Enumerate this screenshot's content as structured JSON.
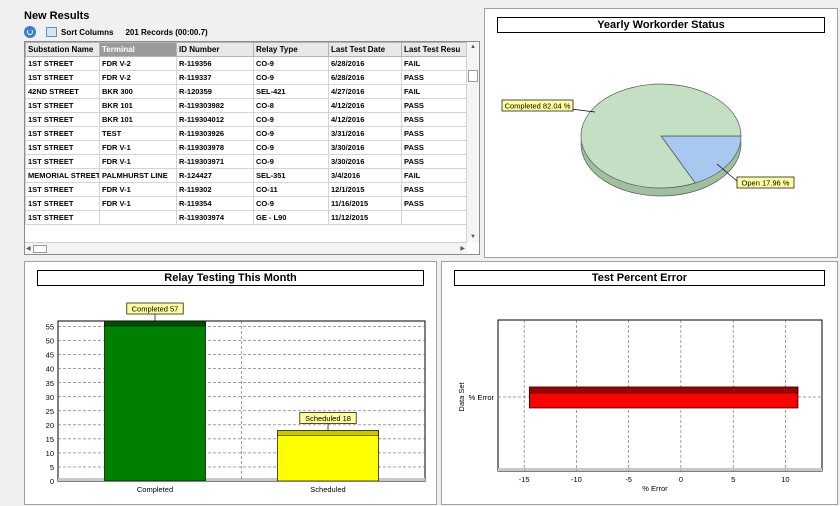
{
  "results": {
    "title": "New Results",
    "sort_label": "Sort Columns",
    "records_label": "201 Records (00:00.7)",
    "columns": [
      "Substation Name",
      "Terminal",
      "ID Number",
      "Relay Type",
      "Last Test Date",
      "Last Test Resu"
    ],
    "rows": [
      [
        "1ST STREET",
        "FDR V-2",
        "R-119356",
        "CO-9",
        "6/28/2016",
        "FAIL"
      ],
      [
        "1ST STREET",
        "FDR V-2",
        "R-119337",
        "CO-9",
        "6/28/2016",
        "PASS"
      ],
      [
        "42ND STREET",
        "BKR 300",
        "R-120359",
        "SEL-421",
        "4/27/2016",
        "FAIL"
      ],
      [
        "1ST STREET",
        "BKR 101",
        "R-119303982",
        "CO-8",
        "4/12/2016",
        "PASS"
      ],
      [
        "1ST STREET",
        "BKR 101",
        "R-119304012",
        "CO-9",
        "4/12/2016",
        "PASS"
      ],
      [
        "1ST STREET",
        "TEST",
        "R-119303926",
        "CO-9",
        "3/31/2016",
        "PASS"
      ],
      [
        "1ST STREET",
        "FDR V-1",
        "R-119303978",
        "CO-9",
        "3/30/2016",
        "PASS"
      ],
      [
        "1ST STREET",
        "FDR V-1",
        "R-119303971",
        "CO-9",
        "3/30/2016",
        "PASS"
      ],
      [
        "MEMORIAL STREET",
        "PALMHURST LINE",
        "R-124427",
        "SEL-351",
        "3/4/2016",
        "FAIL"
      ],
      [
        "1ST STREET",
        "FDR V-1",
        "R-119302",
        "CO-11",
        "12/1/2015",
        "PASS"
      ],
      [
        "1ST STREET",
        "FDR V-1",
        "R-119354",
        "CO-9",
        "11/16/2015",
        "PASS"
      ],
      [
        "1ST STREET",
        "",
        "R-119303974",
        "GE - L90",
        "11/12/2015",
        ""
      ]
    ]
  },
  "pie": {
    "title": "Yearly Workorder Status",
    "chart_data": {
      "type": "pie",
      "slices": [
        {
          "label": "Completed 82.04 %",
          "value": 82.04,
          "color": "#c4dfc4"
        },
        {
          "label": "Open 17.96 %",
          "value": 17.96,
          "color": "#a8c8f0"
        }
      ]
    }
  },
  "bar": {
    "title": "Relay Testing This Month",
    "chart_data": {
      "type": "bar",
      "categories": [
        "Completed",
        "Scheduled"
      ],
      "values": [
        57,
        18
      ],
      "data_labels": [
        "Completed 57",
        "Scheduled 18"
      ],
      "colors": [
        "#008000",
        "#ffff00"
      ],
      "ylim": [
        0,
        57
      ],
      "yticks": [
        0,
        5,
        10,
        15,
        20,
        25,
        30,
        35,
        40,
        45,
        50,
        55
      ]
    }
  },
  "hbar": {
    "title": "Test Percent Error",
    "chart_data": {
      "type": "bar",
      "orientation": "horizontal",
      "categories": [
        "% Error"
      ],
      "ranges": [
        [
          -14.5,
          11.2
        ]
      ],
      "color": "#ff0000",
      "xlim": [
        -17.5,
        13.5
      ],
      "xticks": [
        -15,
        -10,
        -5,
        0,
        5,
        10
      ],
      "xlabel": "% Error",
      "ylabel": "Data Set"
    }
  }
}
